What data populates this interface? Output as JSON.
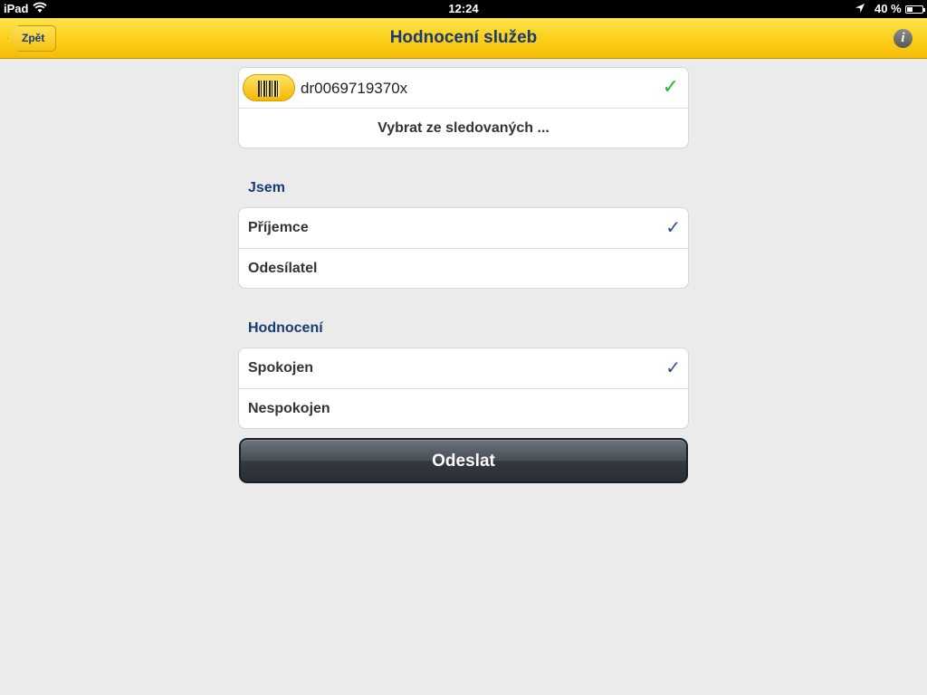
{
  "status_bar": {
    "device": "iPad",
    "time": "12:24",
    "battery_percent": "40 %",
    "battery_level": 0.4
  },
  "nav": {
    "back_label": "Zpět",
    "title": "Hodnocení služeb",
    "info_glyph": "i"
  },
  "shipment": {
    "tracking_number": "dr0069719370x",
    "select_tracked_label": "Vybrat ze sledovaných ..."
  },
  "role_section": {
    "header": "Jsem",
    "options": [
      {
        "label": "Příjemce",
        "selected": true
      },
      {
        "label": "Odesílatel",
        "selected": false
      }
    ]
  },
  "rating_section": {
    "header": "Hodnocení",
    "options": [
      {
        "label": "Spokojen",
        "selected": true
      },
      {
        "label": "Nespokojen",
        "selected": false
      }
    ]
  },
  "submit": {
    "label": "Odeslat"
  },
  "icons": {
    "check": "✓",
    "wifi": "wifi-icon",
    "location": "location-arrow-icon",
    "barcode": "barcode-icon"
  },
  "colors": {
    "nav_yellow": "#fcd220",
    "title_blue": "#1a3a75",
    "check_green": "#2eb82e",
    "check_blue": "#2d4f8a"
  }
}
